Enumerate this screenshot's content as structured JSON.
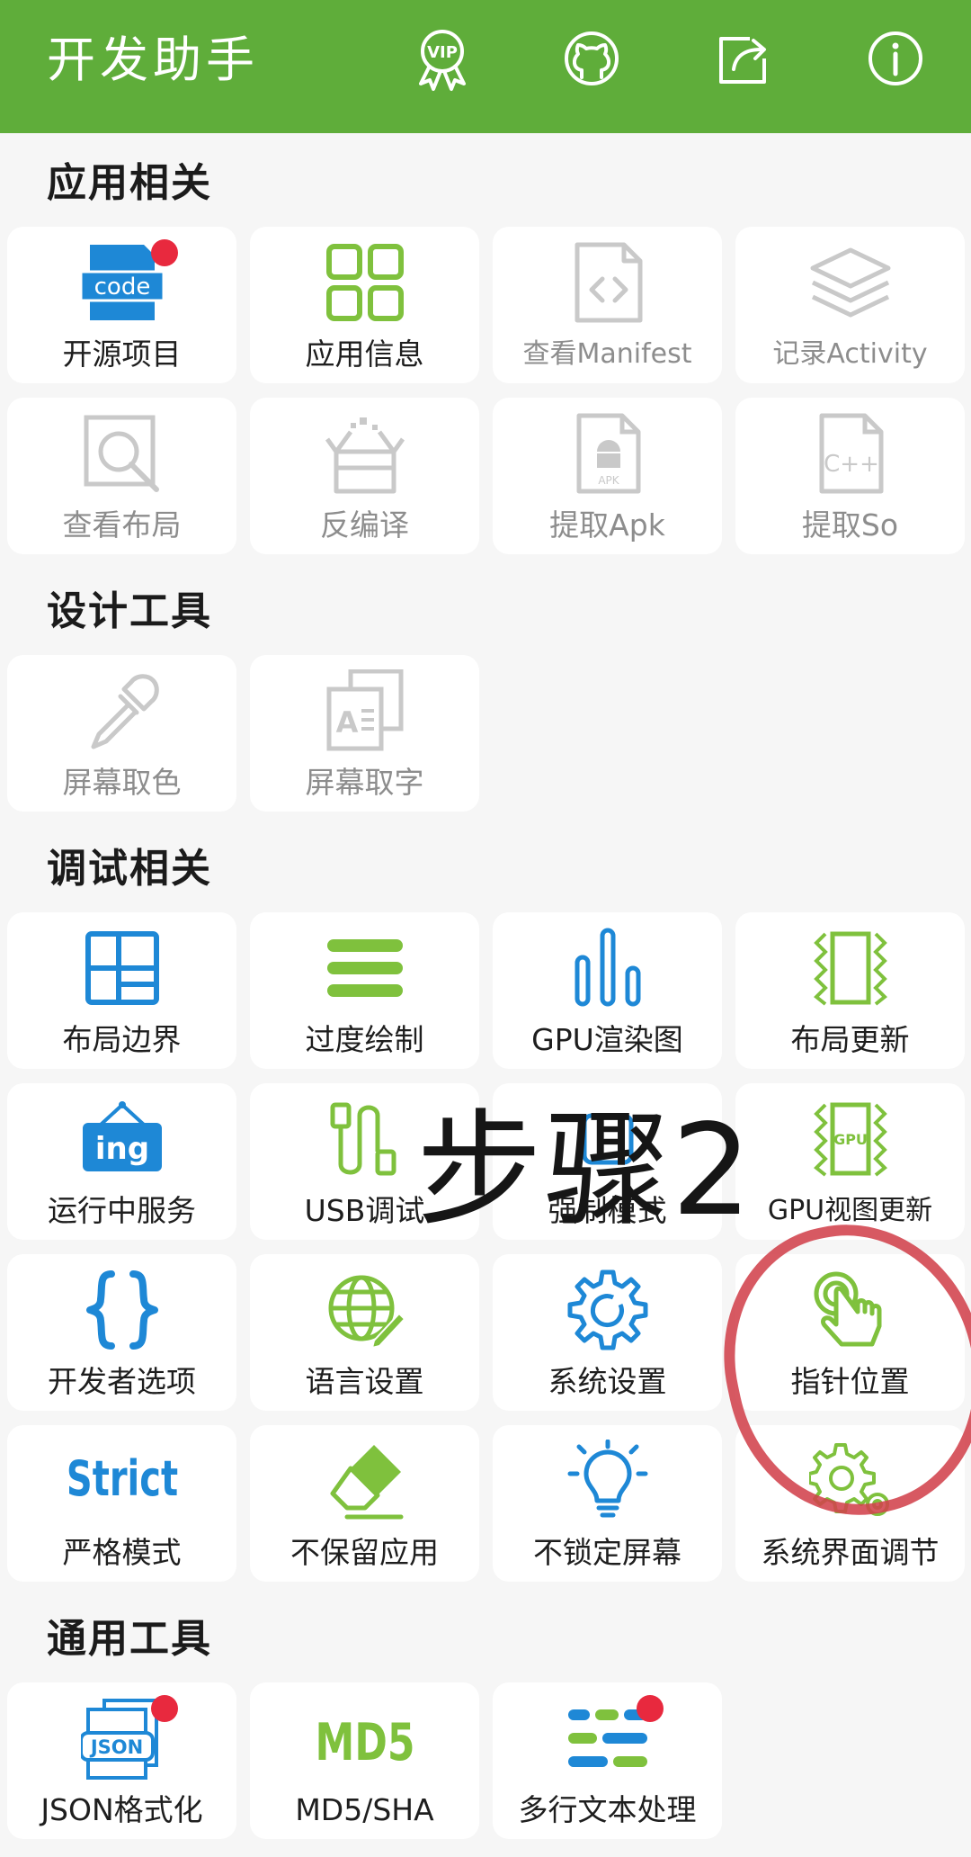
{
  "header": {
    "title": "开发助手",
    "background": "#5fad3a",
    "actions": [
      {
        "icon": "vip-badge-icon",
        "text": "VIP"
      },
      {
        "icon": "github-icon"
      },
      {
        "icon": "share-icon"
      },
      {
        "icon": "info-icon"
      }
    ]
  },
  "sections": [
    {
      "title": "应用相关"
    },
    {
      "title": "设计工具"
    },
    {
      "title": "调试相关"
    },
    {
      "title": "通用工具"
    }
  ],
  "tiles": {
    "open_source": {
      "label": "开源项目",
      "icon": "code-file-icon",
      "icon_text": "code",
      "badge": true
    },
    "app_info": {
      "label": "应用信息",
      "icon": "grid-icon"
    },
    "view_manifest": {
      "label": "查看Manifest",
      "icon": "xml-file-icon",
      "disabled": true
    },
    "record_activity": {
      "label": "记录Activity",
      "icon": "layers-icon",
      "disabled": true
    },
    "view_layout": {
      "label": "查看布局",
      "icon": "magnifier-icon",
      "disabled": true
    },
    "decompile": {
      "label": "反编译",
      "icon": "open-box-icon",
      "disabled": true
    },
    "extract_apk": {
      "label": "提取Apk",
      "icon": "apk-file-icon",
      "icon_text": "APK",
      "disabled": true
    },
    "extract_so": {
      "label": "提取So",
      "icon": "cpp-file-icon",
      "icon_text": "C++",
      "disabled": true
    },
    "screen_color": {
      "label": "屏幕取色",
      "icon": "eyedropper-icon",
      "disabled": true
    },
    "screen_text": {
      "label": "屏幕取字",
      "icon": "text-pages-icon",
      "icon_text": "A",
      "disabled": true
    },
    "layout_bounds": {
      "label": "布局边界",
      "icon": "layout-bounds-icon"
    },
    "overdraw": {
      "label": "过度绘制",
      "icon": "stacked-bars-icon"
    },
    "gpu_render": {
      "label": "GPU渲染图",
      "icon": "bar-chart-icon"
    },
    "layout_update": {
      "label": "布局更新",
      "icon": "layout-update-icon"
    },
    "running_services": {
      "label": "运行中服务",
      "icon": "ing-sign-icon",
      "icon_text": "ing"
    },
    "usb_debug": {
      "label": "USB调试",
      "icon": "usb-cable-icon"
    },
    "force_mode": {
      "label": "强制模式",
      "icon": "hidden-icon"
    },
    "gpu_view_update": {
      "label": "GPU视图更新",
      "icon": "gpu-chip-icon",
      "icon_text": "GPU"
    },
    "developer_options": {
      "label": "开发者选项",
      "icon": "braces-icon"
    },
    "language_settings": {
      "label": "语言设置",
      "icon": "globe-pencil-icon"
    },
    "system_settings": {
      "label": "系统设置",
      "icon": "gear-icon"
    },
    "pointer_location": {
      "label": "指针位置",
      "icon": "pointer-hand-icon"
    },
    "strict_mode": {
      "label": "严格模式",
      "icon": "strict-text-icon",
      "icon_text": "Strict"
    },
    "dont_keep_activities": {
      "label": "不保留应用",
      "icon": "eraser-icon"
    },
    "stay_awake": {
      "label": "不锁定屏幕",
      "icon": "light-bulb-icon"
    },
    "system_ui_tuner": {
      "label": "系统界面调节",
      "icon": "gears-icon"
    },
    "json_format": {
      "label": "JSON格式化",
      "icon": "json-file-icon",
      "icon_text": "JSON",
      "badge": true
    },
    "md5_sha": {
      "label": "MD5/SHA",
      "icon": "md5-text-icon",
      "icon_text": "MD5"
    },
    "multiline_text": {
      "label": "多行文本处理",
      "icon": "text-lines-icon",
      "badge": true
    }
  },
  "annotation": {
    "step_text": "步骤2",
    "highlight_color": "#d2424c"
  },
  "colors": {
    "accent_green": "#7fc13d",
    "accent_blue": "#1e88d6",
    "disabled_gray": "#c9c9c9",
    "badge_red": "#e8293e"
  }
}
